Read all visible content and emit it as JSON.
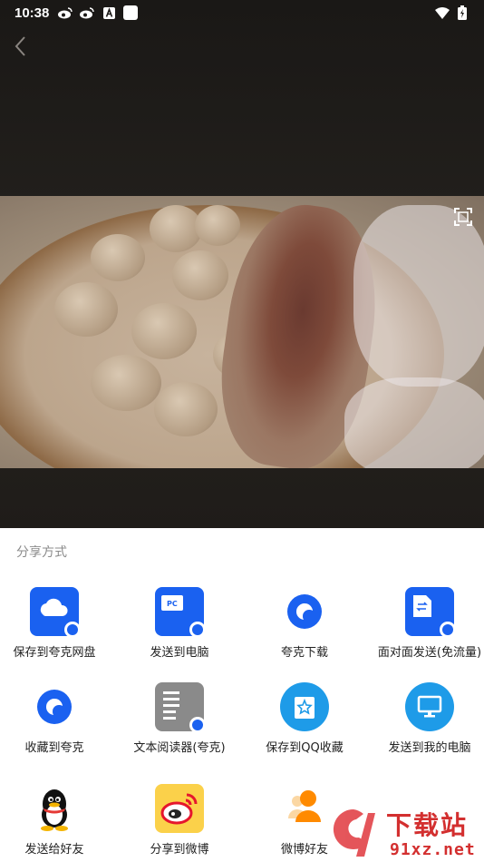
{
  "status_bar": {
    "time": "10:38",
    "left_icons": [
      "weibo-icon",
      "weibo-icon",
      "a-icon",
      "white-square-icon"
    ],
    "right_icons": [
      "wifi-icon",
      "battery-icon"
    ]
  },
  "viewer": {
    "back_icon": "chevron-left-icon",
    "fullscreen_icon": "fullscreen-icon"
  },
  "share": {
    "title": "分享方式",
    "items": [
      {
        "label": "保存到夸克网盘",
        "icon": "cloud-drive-icon"
      },
      {
        "label": "发送到电脑",
        "icon": "pc-icon"
      },
      {
        "label": "夸克下载",
        "icon": "quark-icon"
      },
      {
        "label": "面对面发送(免流量)",
        "icon": "face-to-face-icon"
      },
      {
        "label": "收藏到夸克",
        "icon": "quark-icon"
      },
      {
        "label": "文本阅读器(夸克)",
        "icon": "document-icon"
      },
      {
        "label": "保存到QQ收藏",
        "icon": "qq-favorite-icon"
      },
      {
        "label": "发送到我的电脑",
        "icon": "monitor-icon"
      },
      {
        "label": "发送给好友",
        "icon": "qq-penguin-icon"
      },
      {
        "label": "分享到微博",
        "icon": "weibo-icon"
      },
      {
        "label": "微博好友",
        "icon": "contacts-icon"
      }
    ]
  },
  "watermark": {
    "text": "下载站",
    "url": "91xz.net"
  },
  "colors": {
    "accent": "#1a61f0",
    "light_blue": "#1e9be8",
    "sheet_title": "#8b8b8b"
  }
}
